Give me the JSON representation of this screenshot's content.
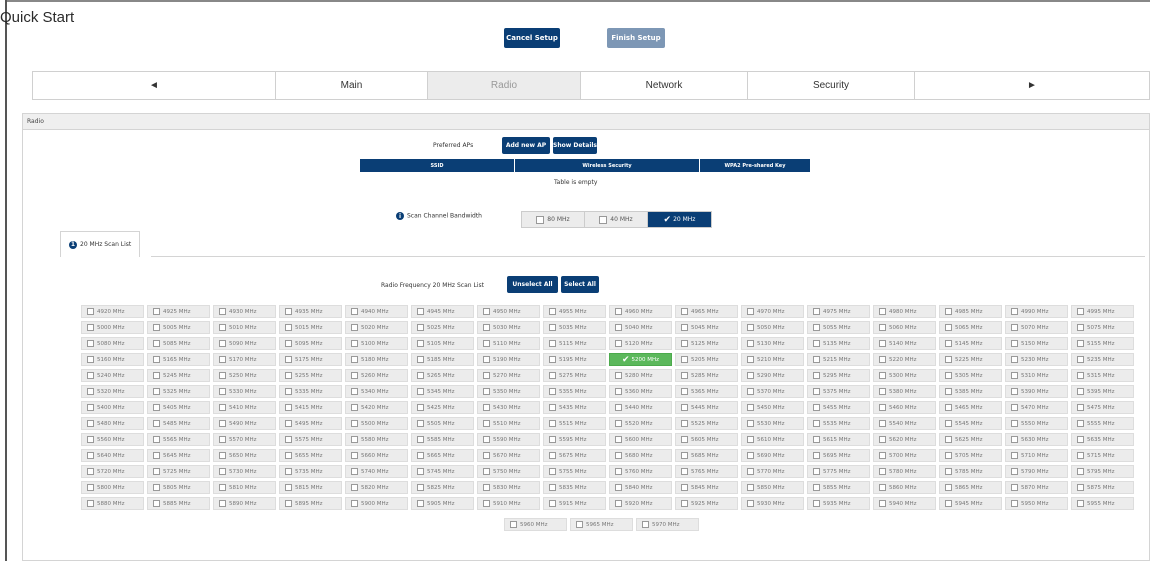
{
  "page": {
    "title": "Quick Start"
  },
  "header_buttons": {
    "cancel": "Cancel Setup",
    "finish": "Finish Setup"
  },
  "tabs": [
    {
      "label": "◄",
      "name": "tab-prev"
    },
    {
      "label": "Main",
      "name": "tab-main"
    },
    {
      "label": "Radio",
      "name": "tab-radio",
      "active": true
    },
    {
      "label": "Network",
      "name": "tab-network"
    },
    {
      "label": "Security",
      "name": "tab-security"
    },
    {
      "label": "►",
      "name": "tab-next"
    }
  ],
  "panel": {
    "title": "Radio"
  },
  "preferred_aps": {
    "label": "Preferred APs",
    "add_button": "Add new AP",
    "details_button": "Show Details",
    "columns": [
      "SSID",
      "Wireless Security",
      "WPA2 Pre-shared Key"
    ],
    "empty_text": "Table is empty"
  },
  "bandwidth": {
    "label": "Scan Channel Bandwidth",
    "options": [
      {
        "label": "80 MHz",
        "selected": false
      },
      {
        "label": "40 MHz",
        "selected": false
      },
      {
        "label": "20 MHz",
        "selected": true
      }
    ]
  },
  "scan_tab": {
    "badge": "1",
    "label": "20 MHz Scan List"
  },
  "scan_list": {
    "label": "Radio Frequency 20 MHz Scan List",
    "unselect_all": "Unselect All",
    "select_all": "Select All",
    "frequencies": [
      "4920 MHz",
      "4925 MHz",
      "4930 MHz",
      "4935 MHz",
      "4940 MHz",
      "4945 MHz",
      "4950 MHz",
      "4955 MHz",
      "4960 MHz",
      "4965 MHz",
      "4970 MHz",
      "4975 MHz",
      "4980 MHz",
      "4985 MHz",
      "4990 MHz",
      "4995 MHz",
      "5000 MHz",
      "5005 MHz",
      "5010 MHz",
      "5015 MHz",
      "5020 MHz",
      "5025 MHz",
      "5030 MHz",
      "5035 MHz",
      "5040 MHz",
      "5045 MHz",
      "5050 MHz",
      "5055 MHz",
      "5060 MHz",
      "5065 MHz",
      "5070 MHz",
      "5075 MHz",
      "5080 MHz",
      "5085 MHz",
      "5090 MHz",
      "5095 MHz",
      "5100 MHz",
      "5105 MHz",
      "5110 MHz",
      "5115 MHz",
      "5120 MHz",
      "5125 MHz",
      "5130 MHz",
      "5135 MHz",
      "5140 MHz",
      "5145 MHz",
      "5150 MHz",
      "5155 MHz",
      "5160 MHz",
      "5165 MHz",
      "5170 MHz",
      "5175 MHz",
      "5180 MHz",
      "5185 MHz",
      "5190 MHz",
      "5195 MHz",
      "5200 MHz",
      "5205 MHz",
      "5210 MHz",
      "5215 MHz",
      "5220 MHz",
      "5225 MHz",
      "5230 MHz",
      "5235 MHz",
      "5240 MHz",
      "5245 MHz",
      "5250 MHz",
      "5255 MHz",
      "5260 MHz",
      "5265 MHz",
      "5270 MHz",
      "5275 MHz",
      "5280 MHz",
      "5285 MHz",
      "5290 MHz",
      "5295 MHz",
      "5300 MHz",
      "5305 MHz",
      "5310 MHz",
      "5315 MHz",
      "5320 MHz",
      "5325 MHz",
      "5330 MHz",
      "5335 MHz",
      "5340 MHz",
      "5345 MHz",
      "5350 MHz",
      "5355 MHz",
      "5360 MHz",
      "5365 MHz",
      "5370 MHz",
      "5375 MHz",
      "5380 MHz",
      "5385 MHz",
      "5390 MHz",
      "5395 MHz",
      "5400 MHz",
      "5405 MHz",
      "5410 MHz",
      "5415 MHz",
      "5420 MHz",
      "5425 MHz",
      "5430 MHz",
      "5435 MHz",
      "5440 MHz",
      "5445 MHz",
      "5450 MHz",
      "5455 MHz",
      "5460 MHz",
      "5465 MHz",
      "5470 MHz",
      "5475 MHz",
      "5480 MHz",
      "5485 MHz",
      "5490 MHz",
      "5495 MHz",
      "5500 MHz",
      "5505 MHz",
      "5510 MHz",
      "5515 MHz",
      "5520 MHz",
      "5525 MHz",
      "5530 MHz",
      "5535 MHz",
      "5540 MHz",
      "5545 MHz",
      "5550 MHz",
      "5555 MHz",
      "5560 MHz",
      "5565 MHz",
      "5570 MHz",
      "5575 MHz",
      "5580 MHz",
      "5585 MHz",
      "5590 MHz",
      "5595 MHz",
      "5600 MHz",
      "5605 MHz",
      "5610 MHz",
      "5615 MHz",
      "5620 MHz",
      "5625 MHz",
      "5630 MHz",
      "5635 MHz",
      "5640 MHz",
      "5645 MHz",
      "5650 MHz",
      "5655 MHz",
      "5660 MHz",
      "5665 MHz",
      "5670 MHz",
      "5675 MHz",
      "5680 MHz",
      "5685 MHz",
      "5690 MHz",
      "5695 MHz",
      "5700 MHz",
      "5705 MHz",
      "5710 MHz",
      "5715 MHz",
      "5720 MHz",
      "5725 MHz",
      "5730 MHz",
      "5735 MHz",
      "5740 MHz",
      "5745 MHz",
      "5750 MHz",
      "5755 MHz",
      "5760 MHz",
      "5765 MHz",
      "5770 MHz",
      "5775 MHz",
      "5780 MHz",
      "5785 MHz",
      "5790 MHz",
      "5795 MHz",
      "5800 MHz",
      "5805 MHz",
      "5810 MHz",
      "5815 MHz",
      "5820 MHz",
      "5825 MHz",
      "5830 MHz",
      "5835 MHz",
      "5840 MHz",
      "5845 MHz",
      "5850 MHz",
      "5855 MHz",
      "5860 MHz",
      "5865 MHz",
      "5870 MHz",
      "5875 MHz",
      "5880 MHz",
      "5885 MHz",
      "5890 MHz",
      "5895 MHz",
      "5900 MHz",
      "5905 MHz",
      "5910 MHz",
      "5915 MHz",
      "5920 MHz",
      "5925 MHz",
      "5930 MHz",
      "5935 MHz",
      "5940 MHz",
      "5945 MHz",
      "5950 MHz",
      "5955 MHz"
    ],
    "extra_frequencies": [
      "5960 MHz",
      "5965 MHz",
      "5970 MHz"
    ],
    "selected": [
      "5200 MHz"
    ]
  },
  "colors": {
    "primary": "#0a3e75",
    "disabled": "#7d97b5",
    "selected": "#5cb85c"
  }
}
